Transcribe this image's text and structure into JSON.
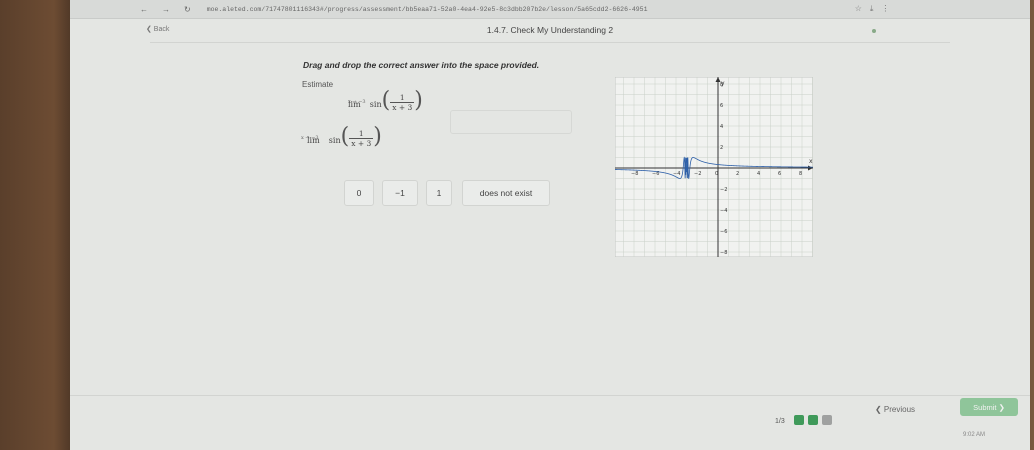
{
  "browser": {
    "nav_icons": [
      "←",
      "→",
      "↻"
    ],
    "url": "moe.aleted.com/71747801116343#/progress/assessment/bb5eaa71-52a0-4ea4-92e5-8c3dbb207b2e/lesson/5a65cdd2-6626-4951",
    "tool_icons": [
      "☆",
      "⤓",
      "⋮"
    ]
  },
  "header": {
    "back_label": "❮ Back",
    "title": "1.4.7. Check My Understanding 2"
  },
  "question": {
    "prompt": "Drag and drop the correct answer into the space provided.",
    "estimate_label": "Estimate",
    "lim_word": "lim",
    "lim_sub": "x → −3",
    "func": "sin",
    "frac_num": "1",
    "frac_den": "x + 3"
  },
  "answer_choices": [
    "0",
    "−1",
    "1",
    "does not exist"
  ],
  "graph": {
    "x_ticks": [
      "−8",
      "−6",
      "−4",
      "−2",
      "0",
      "2",
      "4",
      "6",
      "8"
    ],
    "y_ticks": [
      "8",
      "6",
      "4",
      "2",
      "−2",
      "−4",
      "−6",
      "−8"
    ],
    "x_axis_label": "x",
    "y_axis_label": "y",
    "grid": true
  },
  "footer": {
    "page_indicator": "1/3",
    "previous_label": "❮ Previous",
    "submit_label": "Submit ❯",
    "clock": "9:02 AM",
    "status_colors": [
      "#3f9a5a",
      "#3f9a5a",
      "#9fa1a0"
    ]
  }
}
